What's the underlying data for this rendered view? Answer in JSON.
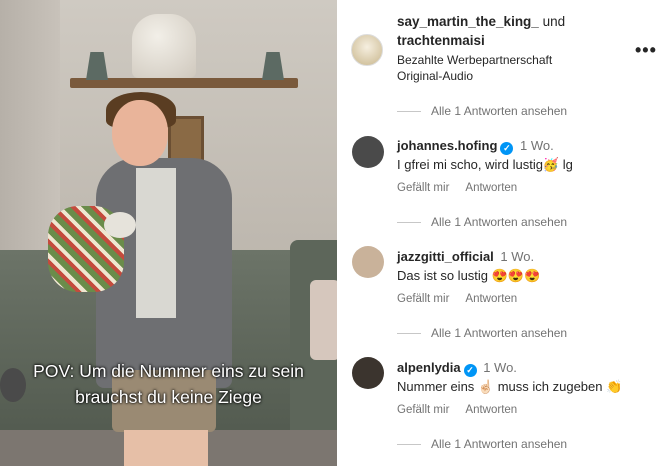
{
  "video": {
    "caption_line1": "POV: Um die Nummer eins zu sein",
    "caption_line2": "brauchst du keine Ziege"
  },
  "header": {
    "account1": "say_martin_the_king_",
    "conjunction": "und",
    "account2": "trachtenmaisi",
    "subtitle": "Bezahlte Werbepartnerschaft",
    "audio": "Original-Audio",
    "more": "•••"
  },
  "comments": [
    {
      "username": "johannes.hofing",
      "verified": true,
      "time": "1 Wo.",
      "text": "I gfrei mi scho, wird lustig🥳 lg",
      "like": "Gefällt mir",
      "reply": "Antworten",
      "avatar_color": "#4a4a4a"
    },
    {
      "username": "jazzgitti_official",
      "verified": false,
      "time": "1 Wo.",
      "text": "Das ist so lustig 😍😍😍",
      "like": "Gefällt mir",
      "reply": "Antworten",
      "avatar_color": "#c9b29a"
    },
    {
      "username": "alpenlydia",
      "verified": true,
      "time": "1 Wo.",
      "text": "Nummer eins ☝🏻 muss ich zugeben 👏",
      "like": "Gefällt mir",
      "reply": "Antworten",
      "avatar_color": "#3b342e"
    }
  ],
  "view_replies": [
    "Alle 1 Antworten ansehen",
    "Alle 1 Antworten ansehen",
    "Alle 1 Antworten ansehen",
    "Alle 1 Antworten ansehen"
  ],
  "colors": {
    "verified_badge": "#0095f6",
    "secondary_text": "#737373"
  }
}
